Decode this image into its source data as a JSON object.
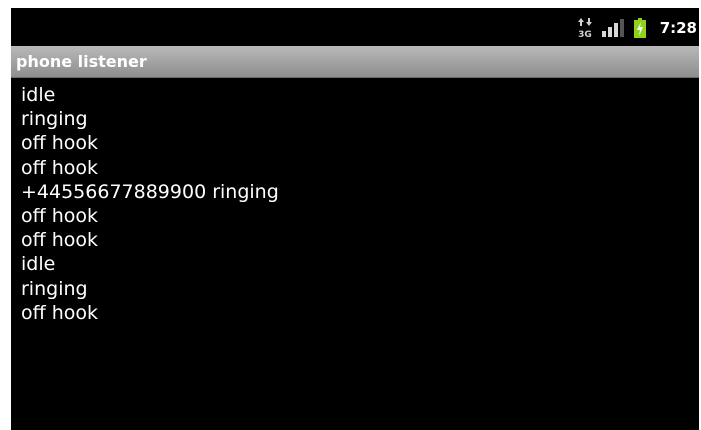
{
  "status_bar": {
    "time": "7:28",
    "network_icon": "3g-data-arrows-icon",
    "signal_icon": "signal-strength-icon",
    "battery_icon": "battery-charging-icon",
    "network_label": "3G"
  },
  "app": {
    "title": "phone listener"
  },
  "log": {
    "entries": [
      "idle",
      "ringing",
      "off hook",
      "off hook",
      "+44556677889900 ringing",
      "off hook",
      "off hook",
      "idle",
      "ringing",
      "off hook"
    ]
  },
  "colors": {
    "screen_background": "#000000",
    "title_bar": "#a3a3a3",
    "text": "#ffffff",
    "battery_accent": "#8ed21c"
  }
}
